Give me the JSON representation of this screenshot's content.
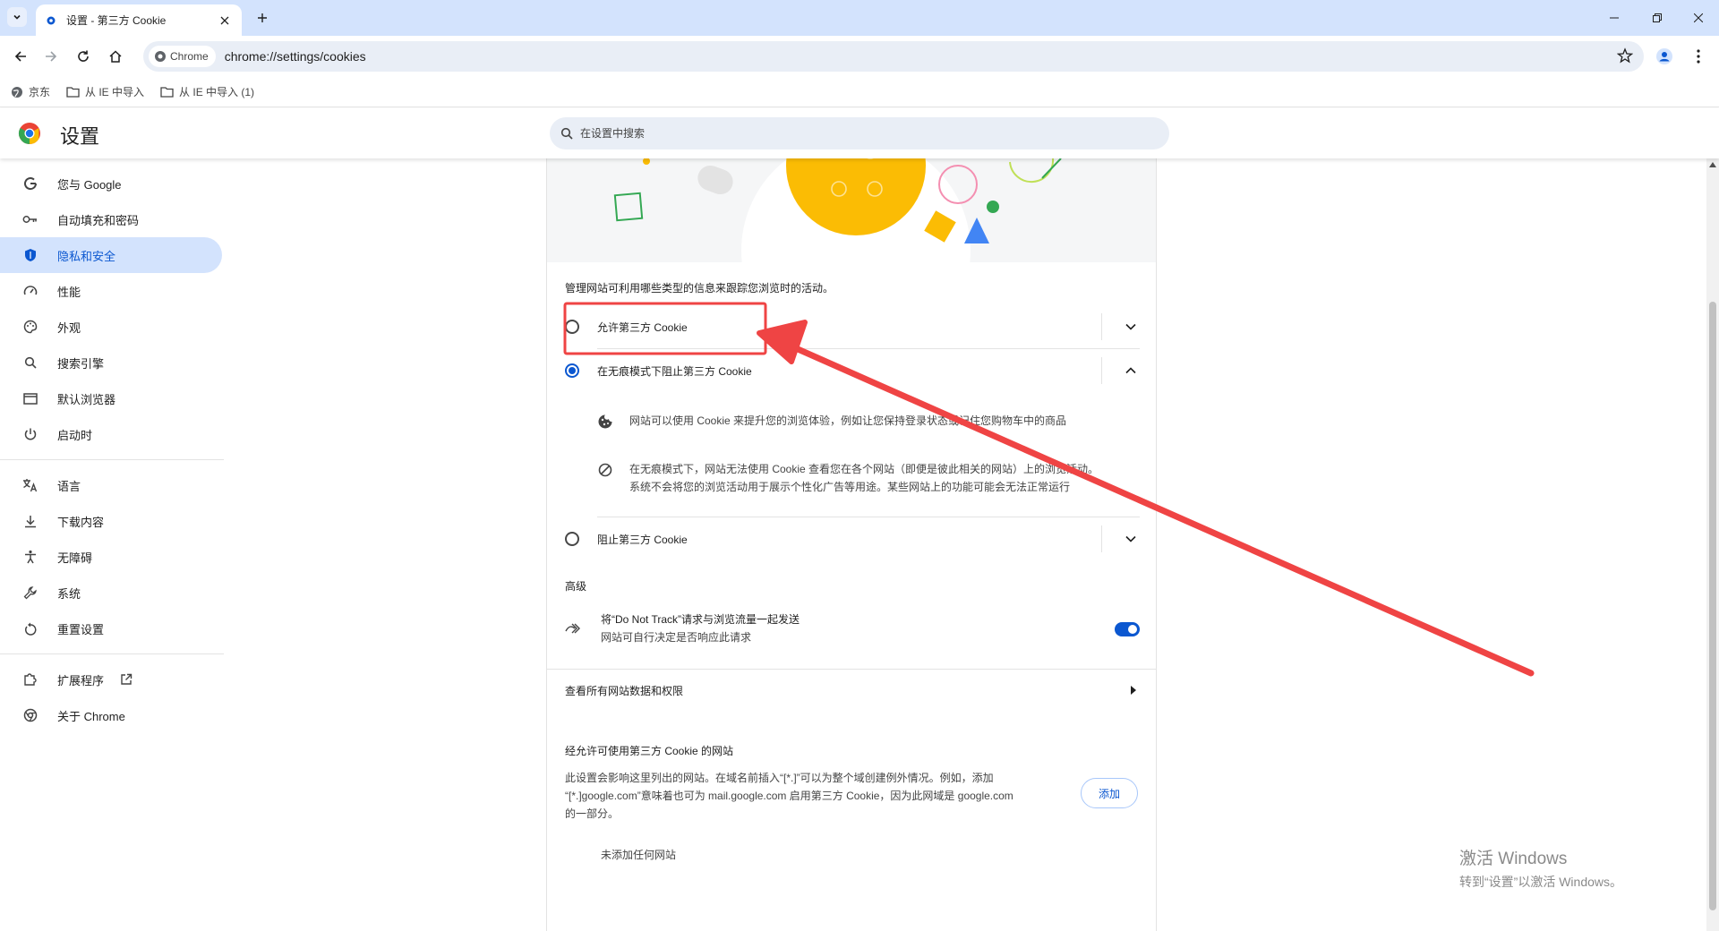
{
  "browser": {
    "tab_title": "设置 - 第三方 Cookie",
    "address_chip": "Chrome",
    "url": "chrome://settings/cookies",
    "bookmarks": [
      "京东",
      "从 IE 中导入",
      "从 IE 中导入 (1)"
    ]
  },
  "settings": {
    "title": "设置",
    "search_placeholder": "在设置中搜索"
  },
  "sidebar": {
    "items": [
      {
        "label": "您与 Google",
        "icon": "google-g-icon"
      },
      {
        "label": "自动填充和密码",
        "icon": "key-icon"
      },
      {
        "label": "隐私和安全",
        "icon": "shield-icon",
        "active": true
      },
      {
        "label": "性能",
        "icon": "speedometer-icon"
      },
      {
        "label": "外观",
        "icon": "palette-icon"
      },
      {
        "label": "搜索引擎",
        "icon": "search-icon"
      },
      {
        "label": "默认浏览器",
        "icon": "browser-window-icon"
      },
      {
        "label": "启动时",
        "icon": "power-icon"
      },
      {
        "label": "语言",
        "icon": "translate-icon"
      },
      {
        "label": "下载内容",
        "icon": "download-icon"
      },
      {
        "label": "无障碍",
        "icon": "accessibility-icon"
      },
      {
        "label": "系统",
        "icon": "wrench-icon"
      },
      {
        "label": "重置设置",
        "icon": "reset-icon"
      },
      {
        "label": "扩展程序",
        "icon": "puzzle-icon"
      },
      {
        "label": "关于 Chrome",
        "icon": "chrome-icon"
      }
    ]
  },
  "cookies": {
    "intro": "管理网站可利用哪些类型的信息来跟踪您浏览时的活动。",
    "options": [
      {
        "label": "允许第三方 Cookie",
        "selected": false,
        "expanded": false
      },
      {
        "label": "在无痕模式下阻止第三方 Cookie",
        "selected": true,
        "expanded": true
      },
      {
        "label": "阻止第三方 Cookie",
        "selected": false,
        "expanded": false
      }
    ],
    "detail_1": "网站可以使用 Cookie 来提升您的浏览体验，例如让您保持登录状态或记住您购物车中的商品",
    "detail_2_line1": "在无痕模式下，网站无法使用 Cookie 查看您在各个网站（即便是彼此相关的网站）上的浏览活动。",
    "detail_2_line2": "系统不会将您的浏览活动用于展示个性化广告等用途。某些网站上的功能可能会无法正常运行",
    "advanced_heading": "高级",
    "dnt_line1": "将“Do Not Track”请求与浏览流量一起发送",
    "dnt_line2": "网站可自行决定是否响应此请求",
    "dnt_enabled": true,
    "view_all_label": "查看所有网站数据和权限",
    "allowed_heading": "经允许可使用第三方 Cookie 的网站",
    "allowed_desc_line1": "此设置会影响这里列出的网站。在域名前插入“[*.]”可以为整个域创建例外情况。例如，添加",
    "allowed_desc_line2": "“[*.]google.com”意味着也可为 mail.google.com 启用第三方 Cookie，因为此网域是 google.com",
    "allowed_desc_line3": "的一部分。",
    "add_button": "添加",
    "empty_text": "未添加任何网站"
  },
  "watermark": {
    "line1": "激活 Windows",
    "line2": "转到“设置”以激活 Windows。"
  },
  "colors": {
    "accent": "#0b57d0",
    "active_nav_bg": "#d3e3fd",
    "annotation_red": "#ef4444"
  }
}
